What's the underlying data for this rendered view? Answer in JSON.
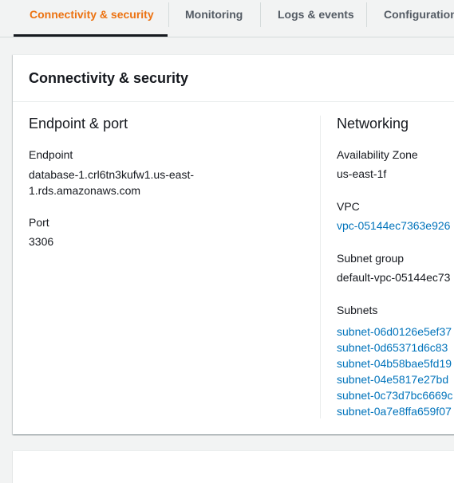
{
  "tabs": [
    {
      "label": "Connectivity & security"
    },
    {
      "label": "Monitoring"
    },
    {
      "label": "Logs & events"
    },
    {
      "label": "Configuration"
    }
  ],
  "panel": {
    "title": "Connectivity & security",
    "endpoint_port": {
      "heading": "Endpoint & port",
      "endpoint_label": "Endpoint",
      "endpoint_line1": "database-1.crl6tn3kufw1.us-east-",
      "endpoint_line2": "1.rds.amazonaws.com",
      "port_label": "Port",
      "port_value": "3306"
    },
    "networking": {
      "heading": "Networking",
      "az_label": "Availability Zone",
      "az_value": "us-east-1f",
      "vpc_label": "VPC",
      "vpc_value": "vpc-05144ec7363e926",
      "subnet_group_label": "Subnet group",
      "subnet_group_value": "default-vpc-05144ec73",
      "subnets_label": "Subnets",
      "subnets": [
        "subnet-06d0126e5ef37",
        "subnet-0d65371d6c83",
        "subnet-04b58bae5fd19",
        "subnet-04e5817e27bd",
        "subnet-0c73d7bc6669c",
        "subnet-0a7e8ffa659f07"
      ]
    }
  },
  "colors": {
    "active_tab": "#ec7211",
    "link": "#0073bb",
    "text": "#16191f",
    "background": "#f2f3f3"
  }
}
